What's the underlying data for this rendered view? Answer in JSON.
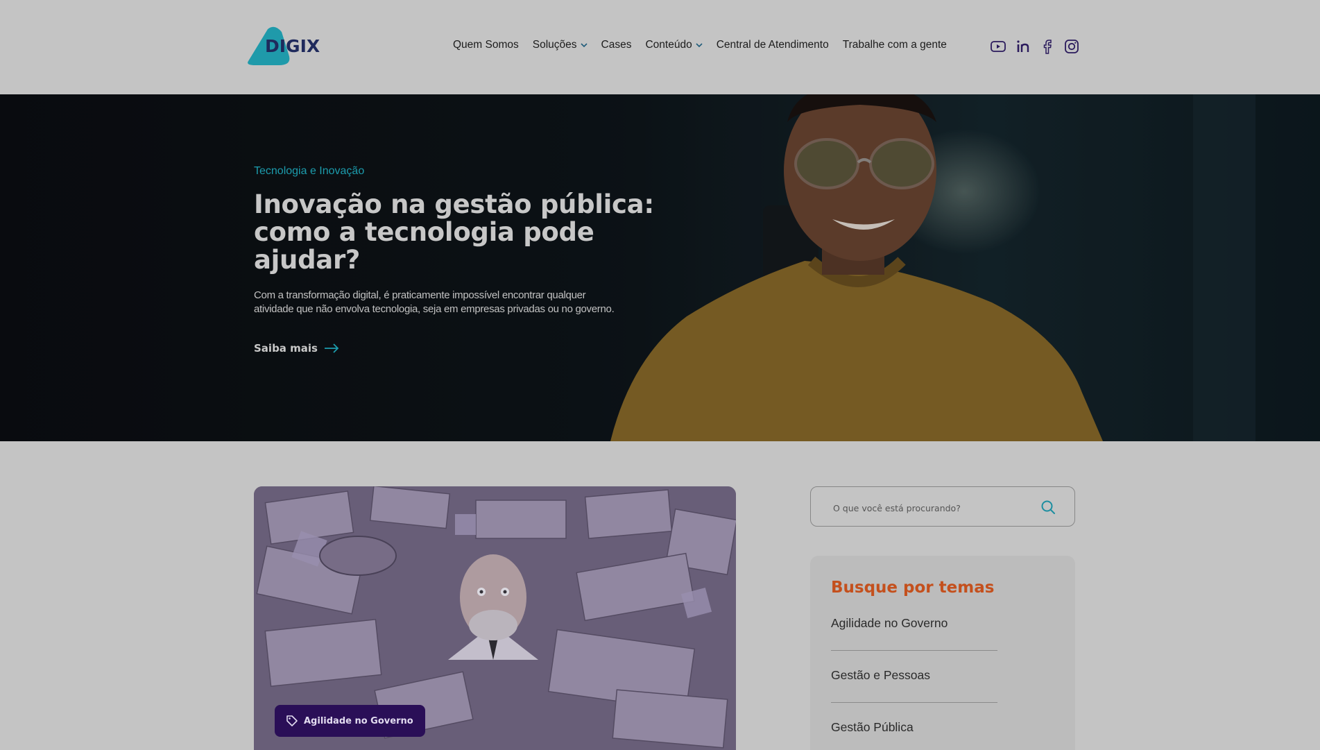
{
  "header": {
    "logo_text": "DIGIX",
    "nav": [
      {
        "label": "Quem Somos",
        "dropdown": false
      },
      {
        "label": "Soluções",
        "dropdown": true
      },
      {
        "label": "Cases",
        "dropdown": false
      },
      {
        "label": "Conteúdo",
        "dropdown": true
      },
      {
        "label": "Central de Atendimento",
        "dropdown": false
      },
      {
        "label": "Trabalhe com a gente",
        "dropdown": false
      }
    ],
    "social_icons": [
      "youtube-icon",
      "linkedin-icon",
      "facebook-icon",
      "instagram-icon"
    ]
  },
  "hero": {
    "category": "Tecnologia e Inovação",
    "title": "Inovação na gestão pública: como a tecnologia pode ajudar?",
    "text": "Com a transformação digital, é praticamente impossível encontrar qualquer atividade que não envolva tecnologia, seja em empresas privadas ou no governo.",
    "cta": "Saiba mais"
  },
  "card": {
    "badge": "Agilidade no Governo"
  },
  "search": {
    "placeholder": "O que você está procurando?"
  },
  "themes": {
    "title": "Busque por temas",
    "items": [
      "Agilidade no Governo",
      "Gestão e Pessoas",
      "Gestão Pública"
    ]
  },
  "colors": {
    "background": "#c4c4c4",
    "accent_teal": "#1c9cad",
    "brand_navy": "#1f2a5c",
    "themes_title": "#c4501d",
    "badge_bg": "#2a0f57"
  }
}
